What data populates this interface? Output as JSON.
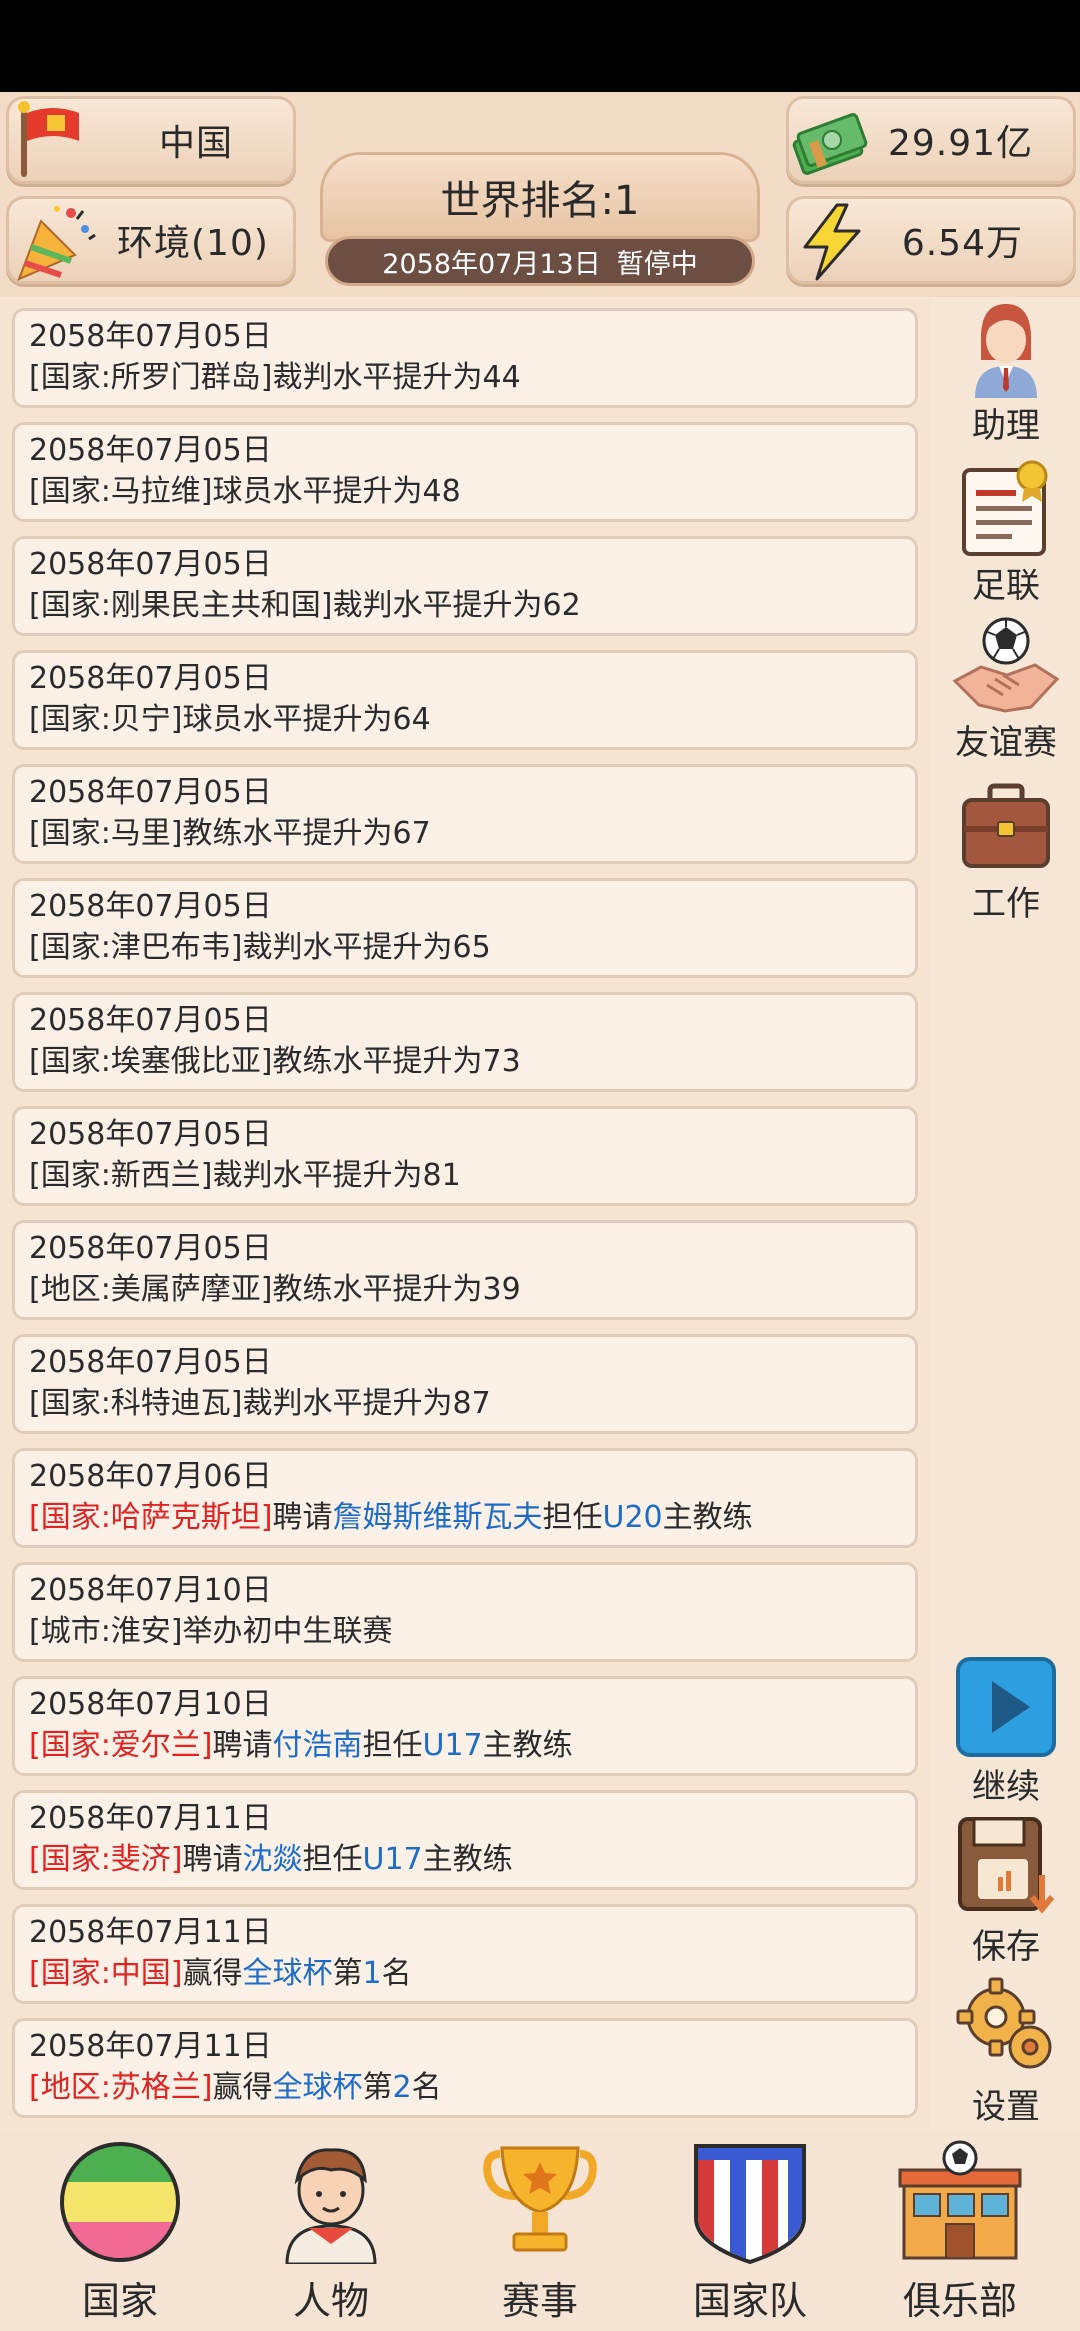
{
  "header": {
    "country": "中国",
    "environment": "环境(10)",
    "money": "29.91亿",
    "energy": "6.54万",
    "world_rank": "世界排名:1",
    "date": "2058年07月13日",
    "status": "暂停中"
  },
  "feed": [
    {
      "date": "2058年07月05日",
      "parts": [
        {
          "t": "[国家:所罗门群岛]裁判水平提升为44",
          "c": ""
        }
      ]
    },
    {
      "date": "2058年07月05日",
      "parts": [
        {
          "t": "[国家:马拉维]球员水平提升为48",
          "c": ""
        }
      ]
    },
    {
      "date": "2058年07月05日",
      "parts": [
        {
          "t": "[国家:刚果民主共和国]裁判水平提升为62",
          "c": ""
        }
      ]
    },
    {
      "date": "2058年07月05日",
      "parts": [
        {
          "t": "[国家:贝宁]球员水平提升为64",
          "c": ""
        }
      ]
    },
    {
      "date": "2058年07月05日",
      "parts": [
        {
          "t": "[国家:马里]教练水平提升为67",
          "c": ""
        }
      ]
    },
    {
      "date": "2058年07月05日",
      "parts": [
        {
          "t": "[国家:津巴布韦]裁判水平提升为65",
          "c": ""
        }
      ]
    },
    {
      "date": "2058年07月05日",
      "parts": [
        {
          "t": "[国家:埃塞俄比亚]教练水平提升为73",
          "c": ""
        }
      ]
    },
    {
      "date": "2058年07月05日",
      "parts": [
        {
          "t": "[国家:新西兰]裁判水平提升为81",
          "c": ""
        }
      ]
    },
    {
      "date": "2058年07月05日",
      "parts": [
        {
          "t": "[地区:美属萨摩亚]教练水平提升为39",
          "c": ""
        }
      ]
    },
    {
      "date": "2058年07月05日",
      "parts": [
        {
          "t": "[国家:科特迪瓦]裁判水平提升为87",
          "c": ""
        }
      ]
    },
    {
      "date": "2058年07月06日",
      "parts": [
        {
          "t": "[国家:哈萨克斯坦]",
          "c": "red"
        },
        {
          "t": "聘请",
          "c": ""
        },
        {
          "t": "詹姆斯维斯瓦夫",
          "c": "blue"
        },
        {
          "t": "担任",
          "c": ""
        },
        {
          "t": "U20",
          "c": "blue"
        },
        {
          "t": "主教练",
          "c": ""
        }
      ]
    },
    {
      "date": "2058年07月10日",
      "parts": [
        {
          "t": "[城市:淮安]举办初中生联赛",
          "c": ""
        }
      ]
    },
    {
      "date": "2058年07月10日",
      "parts": [
        {
          "t": "[国家:爱尔兰]",
          "c": "red"
        },
        {
          "t": "聘请",
          "c": ""
        },
        {
          "t": "付浩南",
          "c": "blue"
        },
        {
          "t": "担任",
          "c": ""
        },
        {
          "t": "U17",
          "c": "blue"
        },
        {
          "t": "主教练",
          "c": ""
        }
      ]
    },
    {
      "date": "2058年07月11日",
      "parts": [
        {
          "t": "[国家:斐济]",
          "c": "red"
        },
        {
          "t": "聘请",
          "c": ""
        },
        {
          "t": "沈燚",
          "c": "blue"
        },
        {
          "t": "担任",
          "c": ""
        },
        {
          "t": "U17",
          "c": "blue"
        },
        {
          "t": "主教练",
          "c": ""
        }
      ]
    },
    {
      "date": "2058年07月11日",
      "parts": [
        {
          "t": "[国家:中国]",
          "c": "red"
        },
        {
          "t": "赢得",
          "c": ""
        },
        {
          "t": "全球杯",
          "c": "blue"
        },
        {
          "t": "第",
          "c": ""
        },
        {
          "t": "1",
          "c": "blue"
        },
        {
          "t": "名",
          "c": ""
        }
      ]
    },
    {
      "date": "2058年07月11日",
      "parts": [
        {
          "t": "[地区:苏格兰]",
          "c": "red"
        },
        {
          "t": "赢得",
          "c": ""
        },
        {
          "t": "全球杯",
          "c": "blue"
        },
        {
          "t": "第",
          "c": ""
        },
        {
          "t": "2",
          "c": "blue"
        },
        {
          "t": "名",
          "c": ""
        }
      ]
    }
  ],
  "sidebar": {
    "assistant": "助理",
    "federation": "足联",
    "friendly": "友谊赛",
    "work": "工作",
    "continue": "继续",
    "save": "保存",
    "settings": "设置"
  },
  "nav": {
    "country": "国家",
    "people": "人物",
    "events": "赛事",
    "national_team": "国家队",
    "club": "俱乐部"
  },
  "icons": [
    "flag-icon",
    "party-popper-icon",
    "money-icon",
    "lightning-icon",
    "assistant-icon",
    "federation-icon",
    "handshake-icon",
    "briefcase-icon",
    "play-icon",
    "save-icon",
    "settings-icon",
    "country-icon",
    "people-icon",
    "trophy-icon",
    "national-team-icon",
    "club-icon"
  ]
}
